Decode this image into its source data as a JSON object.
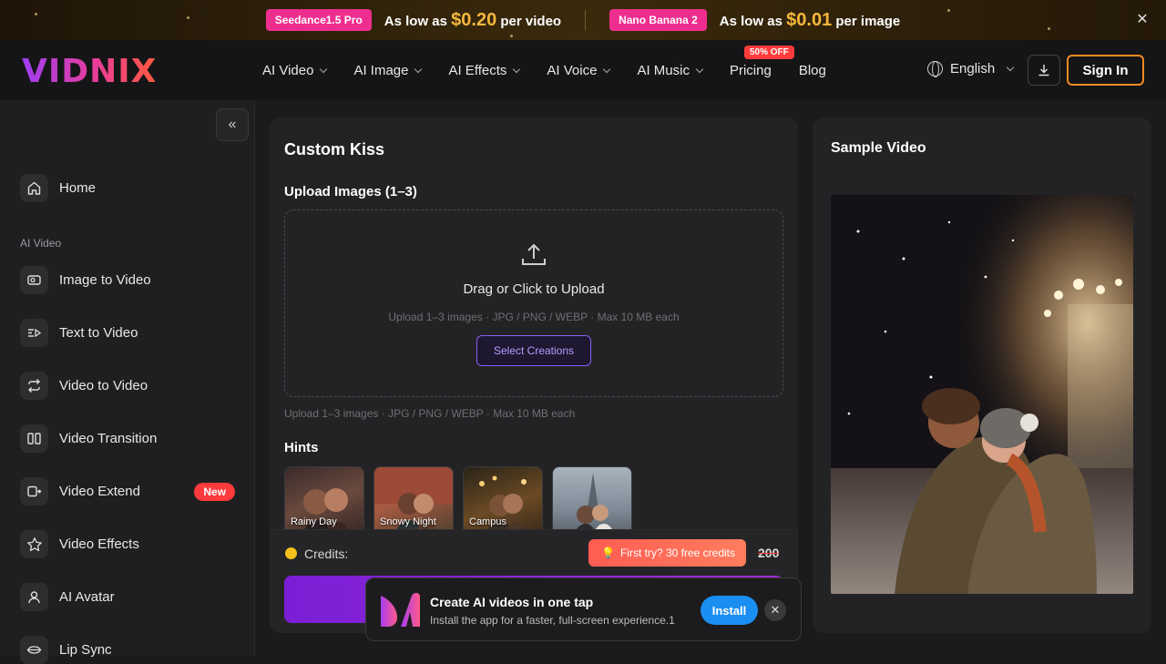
{
  "promo": {
    "offer1": {
      "badge": "Seedance1.5 Pro",
      "prefix": "As low as",
      "price": "$0.20",
      "suffix": "per video"
    },
    "offer2": {
      "badge": "Nano Banana 2",
      "prefix": "As low as",
      "price": "$0.01",
      "suffix": "per image"
    },
    "close_icon": "close-icon"
  },
  "nav": {
    "logo": "VIDNIX",
    "menu": [
      {
        "label": "AI Video"
      },
      {
        "label": "AI Image"
      },
      {
        "label": "AI Effects"
      },
      {
        "label": "AI Voice"
      },
      {
        "label": "AI Music"
      },
      {
        "label": "Pricing",
        "badge": "50% OFF"
      },
      {
        "label": "Blog"
      }
    ],
    "language": "English",
    "sign_in": "Sign In"
  },
  "sidebar": {
    "home": "Home",
    "section": "AI Video",
    "items": [
      {
        "label": "Image to Video",
        "icon": "image-video-icon"
      },
      {
        "label": "Text to Video",
        "icon": "text-video-icon"
      },
      {
        "label": "Video to Video",
        "icon": "repeat-icon"
      },
      {
        "label": "Video Transition",
        "icon": "transition-icon"
      },
      {
        "label": "Video Extend",
        "icon": "extend-icon",
        "badge": "New"
      },
      {
        "label": "Video Effects",
        "icon": "star-icon"
      },
      {
        "label": "AI Avatar",
        "icon": "user-icon"
      },
      {
        "label": "Lip Sync",
        "icon": "lips-icon"
      }
    ]
  },
  "main": {
    "title": "Custom Kiss",
    "upload_title": "Upload Images (1–3)",
    "dropzone_title": "Drag or Click to Upload",
    "dropzone_sub": "Upload 1–3 images · JPG / PNG / WEBP · Max 10 MB each",
    "select_button": "Select Creations",
    "upload_note": "Upload 1–3 images · JPG / PNG / WEBP · Max 10 MB each",
    "hints_title": "Hints",
    "hints": [
      {
        "label": "Rainy Day"
      },
      {
        "label": "Snowy Night"
      },
      {
        "label": "Campus"
      },
      {
        "label": ""
      }
    ],
    "credits_label": "Credits:",
    "first_try": "First try? 30 free credits",
    "credits_cost": "200"
  },
  "sample": {
    "title": "Sample Video"
  },
  "toast": {
    "title": "Create AI videos in one tap",
    "subtitle": "Install the app for a faster, full-screen experience.1",
    "install": "Install"
  },
  "colors": {
    "accent_orange": "#f28a1e",
    "promo_pink": "#ee2e8e",
    "price_gold": "#f6b73c",
    "badge_red": "#ff3b3b",
    "purple": "#8a5cf5",
    "install_blue": "#1b8ef2"
  }
}
